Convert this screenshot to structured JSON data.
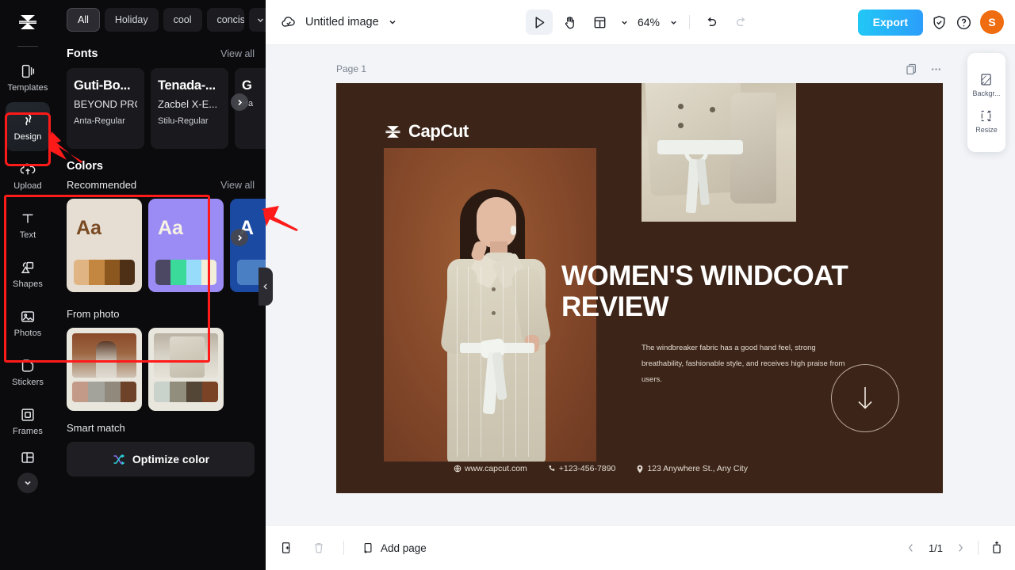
{
  "rail": {
    "logo": "capcut-logo",
    "items": [
      {
        "label": "Templates",
        "icon": "templates-icon",
        "active": false
      },
      {
        "label": "Design",
        "icon": "design-icon",
        "active": true
      },
      {
        "label": "Upload",
        "icon": "upload-icon",
        "active": false
      },
      {
        "label": "Text",
        "icon": "text-icon",
        "active": false
      },
      {
        "label": "Shapes",
        "icon": "shapes-icon",
        "active": false
      },
      {
        "label": "Photos",
        "icon": "photos-icon",
        "active": false
      },
      {
        "label": "Stickers",
        "icon": "stickers-icon",
        "active": false
      },
      {
        "label": "Frames",
        "icon": "frames-icon",
        "active": false
      }
    ],
    "more": "chevron-down-icon"
  },
  "panel": {
    "chips": [
      {
        "label": "All",
        "selected": true
      },
      {
        "label": "Holiday",
        "selected": false
      },
      {
        "label": "cool",
        "selected": false
      },
      {
        "label": "concise",
        "selected": false
      }
    ],
    "chips_expand": "chevron-down-icon",
    "fonts": {
      "title": "Fonts",
      "view_all": "View all",
      "cards": [
        {
          "line1": "Guti-Bo...",
          "line2": "BEYOND PRO...",
          "line3": "Anta-Regular"
        },
        {
          "line1": "Tenada-...",
          "line2": "Zacbel X-E...",
          "line3": "Stilu-Regular"
        },
        {
          "line1": "G",
          "line2": "",
          "line3": "Ha"
        }
      ]
    },
    "colors": {
      "title": "Colors",
      "recommended_label": "Recommended",
      "view_all": "View all",
      "palettes": [
        {
          "aa": "Aa",
          "bg": "#e6ded3",
          "aa_color": "#7a4a22",
          "swatches": [
            "#e0b583",
            "#c38742",
            "#8c571f",
            "#4e3016"
          ]
        },
        {
          "aa": "Aa",
          "bg": "#9b8cf5",
          "aa_color": "#f6f2e4",
          "swatches": [
            "#4c4763",
            "#3bd99a",
            "#97dcfb",
            "#f3eeda"
          ]
        },
        {
          "aa": "A",
          "bg": "#1b4aa3",
          "aa_color": "#ffffff",
          "swatches": [
            "#4a7fc4",
            "#4a7fc4",
            "#4a7fc4",
            "#4a7fc4"
          ]
        }
      ]
    },
    "from_photo": {
      "title": "From photo",
      "cards": [
        {
          "swatches": [
            "#c39a87",
            "#a3a39c",
            "#918a7c",
            "#6e4228"
          ]
        },
        {
          "swatches": [
            "#c9d2cb",
            "#918e7e",
            "#544636",
            "#7a4326"
          ]
        }
      ]
    },
    "smart_match": {
      "title": "Smart match",
      "button_label": "Optimize color",
      "button_icon": "shuffle-icon"
    },
    "collapse_handle": "chevron-left-icon"
  },
  "topbar": {
    "cloud_icon": "cloud-saved-icon",
    "doc_title": "Untitled image",
    "doc_caret": "chevron-down-icon",
    "tools": [
      {
        "name": "select-tool",
        "icon": "cursor-icon",
        "active": true
      },
      {
        "name": "hand-tool",
        "icon": "hand-icon",
        "active": false
      },
      {
        "name": "layout-tool",
        "icon": "layout-icon",
        "active": false
      }
    ],
    "zoom": "64%",
    "zoom_caret": "chevron-down-icon",
    "undo": "undo-icon",
    "redo": "redo-icon",
    "export_label": "Export",
    "shield_icon": "shield-icon",
    "help_icon": "help-icon",
    "avatar_initial": "S",
    "avatar_color": "#ef6c10",
    "export_gradient_from": "#22c8f5",
    "export_gradient_to": "#2b9dfb"
  },
  "canvas": {
    "page_label": "Page 1",
    "duplicate_icon": "duplicate-page-icon",
    "more_icon": "more-horizontal-icon",
    "poster": {
      "background": "#3c2518",
      "brand": "CapCut",
      "brand_icon": "capcut-logo",
      "headline": "WOMEN'S WINDCOAT REVIEW",
      "body": "The windbreaker fabric has a good hand feel, strong breathability, fashionable style, and receives high praise from users.",
      "arrow_icon": "arrow-down-icon",
      "footer": [
        {
          "icon": "globe-icon",
          "text": "www.capcut.com"
        },
        {
          "icon": "phone-icon",
          "text": "+123-456-7890"
        },
        {
          "icon": "location-icon",
          "text": "123 Anywhere St., Any City"
        }
      ]
    },
    "right_tools": [
      {
        "label": "Backgr...",
        "icon": "background-icon"
      },
      {
        "label": "Resize",
        "icon": "resize-icon"
      }
    ]
  },
  "bottombar": {
    "duplicate_icon": "duplicate-icon",
    "delete_icon": "trash-icon",
    "add_page_label": "Add page",
    "add_page_icon": "add-page-icon",
    "prev_icon": "chevron-left-icon",
    "page_count": "1/1",
    "next_icon": "chevron-right-icon",
    "expand_icon": "expand-icon"
  },
  "annotations": {
    "highlight_color": "#ff1a1a",
    "boxes": [
      "design-rail-item",
      "colors-section"
    ],
    "arrows": [
      "arrow-to-design",
      "arrow-to-colors"
    ]
  }
}
